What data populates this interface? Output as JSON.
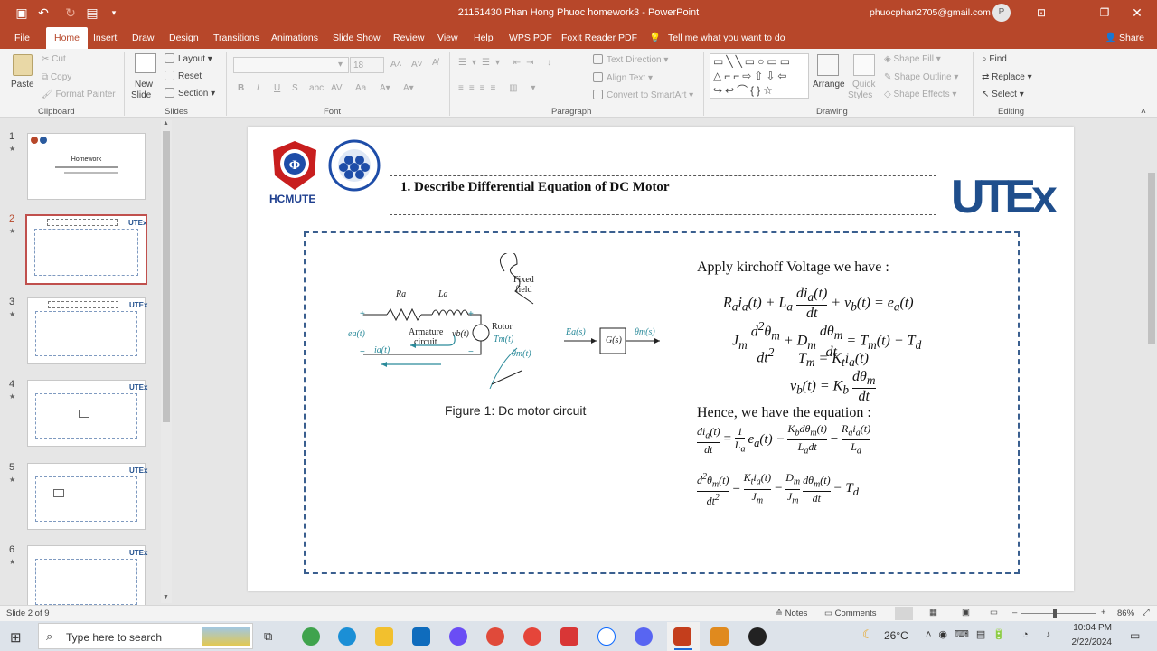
{
  "window": {
    "title": "21151430 Phan Hong Phuoc homework3  -  PowerPoint",
    "account_email": "phuocphan2705@gmail.com",
    "avatar_letter": "P"
  },
  "tabs": [
    "File",
    "Home",
    "Insert",
    "Draw",
    "Design",
    "Transitions",
    "Animations",
    "Slide Show",
    "Review",
    "View",
    "Help",
    "WPS PDF",
    "Foxit Reader PDF"
  ],
  "tell_me": "Tell me what you want to do",
  "share": "Share",
  "ribbon": {
    "clipboard": {
      "paste": "Paste",
      "cut": "Cut",
      "copy": "Copy",
      "format_painter": "Format Painter",
      "group": "Clipboard"
    },
    "slides": {
      "new_slide_1": "New",
      "new_slide_2": "Slide",
      "layout": "Layout",
      "reset": "Reset",
      "section": "Section",
      "group": "Slides"
    },
    "font": {
      "size": "18",
      "group": "Font",
      "bold": "B",
      "italic": "I",
      "underline": "U",
      "strike": "S",
      "spacing": "AV",
      "case": "Aa"
    },
    "paragraph": {
      "text_direction": "Text Direction",
      "align_text": "Align Text",
      "smartart": "Convert to SmartArt",
      "group": "Paragraph"
    },
    "drawing": {
      "arrange": "Arrange",
      "quick_styles_1": "Quick",
      "quick_styles_2": "Styles",
      "shape_fill": "Shape Fill",
      "shape_outline": "Shape Outline",
      "shape_effects": "Shape Effects",
      "group": "Drawing"
    },
    "editing": {
      "find": "Find",
      "replace": "Replace",
      "select": "Select",
      "group": "Editing"
    }
  },
  "thumbnails": [
    {
      "num": "1",
      "star": "★",
      "title": "Homework"
    },
    {
      "num": "2",
      "star": "★"
    },
    {
      "num": "3",
      "star": "★"
    },
    {
      "num": "4",
      "star": "★"
    },
    {
      "num": "5",
      "star": "★"
    },
    {
      "num": "6",
      "star": "★"
    }
  ],
  "slide": {
    "logo_text": "HCMUTE",
    "brand": "UTEx",
    "title": "1. Describe Differential Equation of DC Motor",
    "figure_caption": "Figure 1: Dc motor circuit",
    "circuit": {
      "fixed_field": "Fixed\nfield",
      "ra": "Ra",
      "la": "La",
      "armature": "Armature",
      "circuit": "circuit",
      "rotor": "Rotor",
      "ea": "ea(t)",
      "ia": "ia(t)",
      "vb": "vb(t)",
      "tm": "Tm(t)",
      "theta": "θm(t)",
      "plus": "+",
      "minus": "−",
      "block_in": "Ea(s)",
      "block": "G(s)",
      "block_out": "θm(s)"
    },
    "intro": "Apply kirchoff Voltage we have :",
    "hence": "Hence, we have the equation :"
  },
  "status": {
    "slide_count": "Slide 2 of 9",
    "notes": "Notes",
    "comments": "Comments",
    "zoom": "86%"
  },
  "taskbar": {
    "search_placeholder": "Type here to search",
    "temperature": "26°C",
    "time": "10:04 PM",
    "date": "2/22/2024"
  }
}
